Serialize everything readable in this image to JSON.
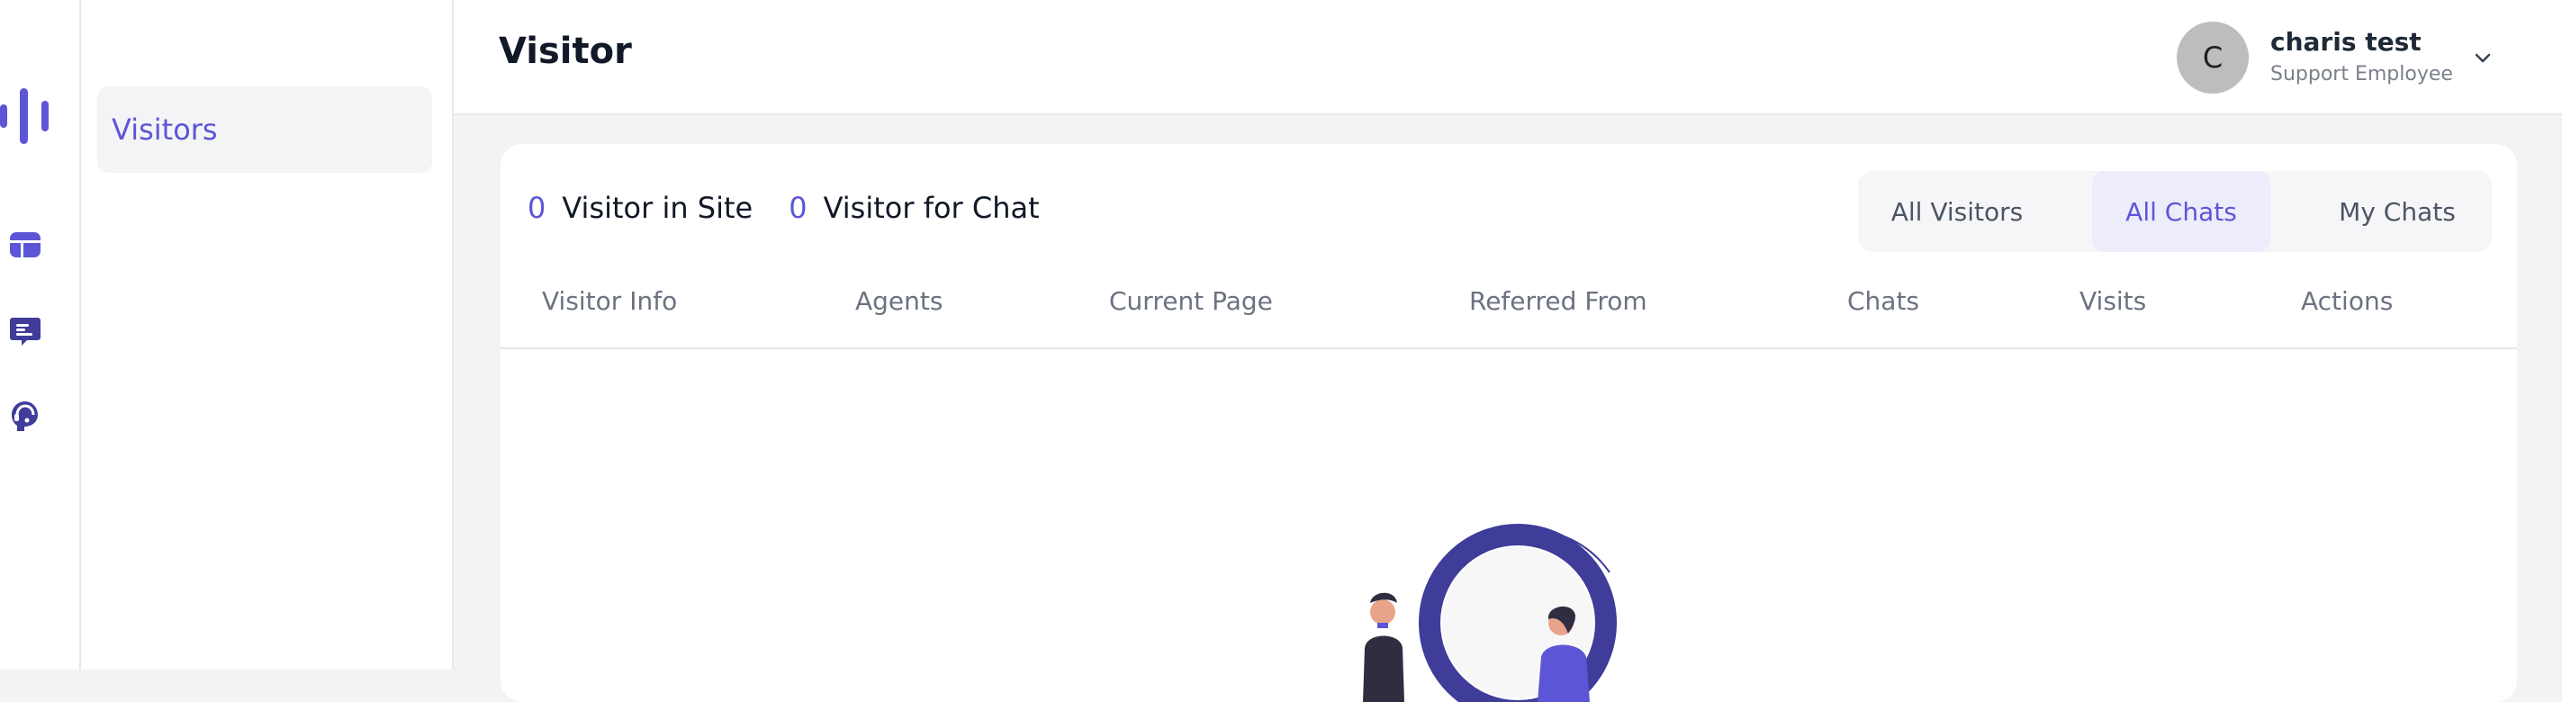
{
  "sidebar": {
    "items": [
      {
        "icon": "dashboard-icon"
      },
      {
        "icon": "chat-icon"
      },
      {
        "icon": "support-agent-icon"
      }
    ]
  },
  "subnav": {
    "active_item": "Visitors"
  },
  "header": {
    "title": "Visitor",
    "user": {
      "initial": "C",
      "name": "charis test",
      "role": "Support Employee"
    }
  },
  "stats": [
    {
      "count": "0",
      "label": "Visitor in Site"
    },
    {
      "count": "0",
      "label": "Visitor for Chat"
    }
  ],
  "tabs": [
    {
      "label": "All Visitors"
    },
    {
      "label": "All Chats",
      "active": true
    },
    {
      "label": "My Chats"
    }
  ],
  "table": {
    "columns": [
      "Visitor Info",
      "Agents",
      "Current Page",
      "Referred From",
      "Chats",
      "Visits",
      "Actions"
    ],
    "rows": []
  },
  "colors": {
    "accent": "#5c56d6",
    "illustration": "#3f3d99"
  }
}
